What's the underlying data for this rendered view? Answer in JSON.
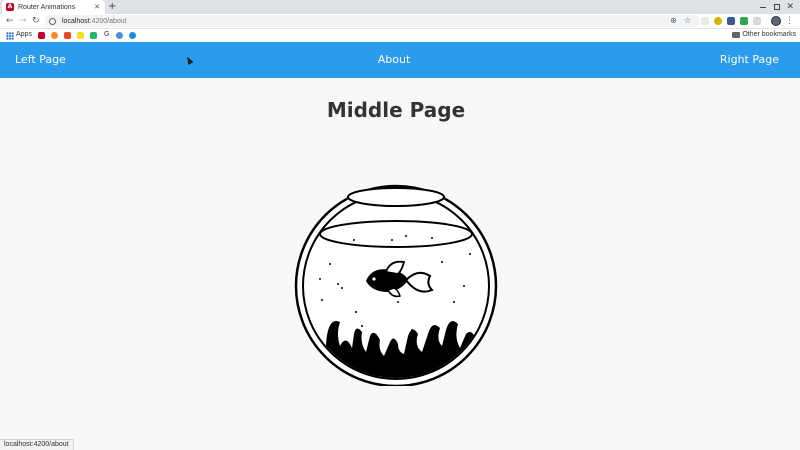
{
  "browser": {
    "tab_title": "Router Animations",
    "tab_favicon_letter": "A",
    "url_host": "localhost",
    "url_path": ":4200/about",
    "bookmarks": {
      "apps_label": "Apps",
      "g_label": "G",
      "other_label": "Other bookmarks"
    },
    "status_url": "localhost:4200/about"
  },
  "nav": {
    "left_label": "Left Page",
    "about_label": "About",
    "right_label": "Right Page",
    "color": "#2b9cec"
  },
  "main": {
    "title": "Middle Page",
    "illustration": "fishbowl-with-fish"
  }
}
